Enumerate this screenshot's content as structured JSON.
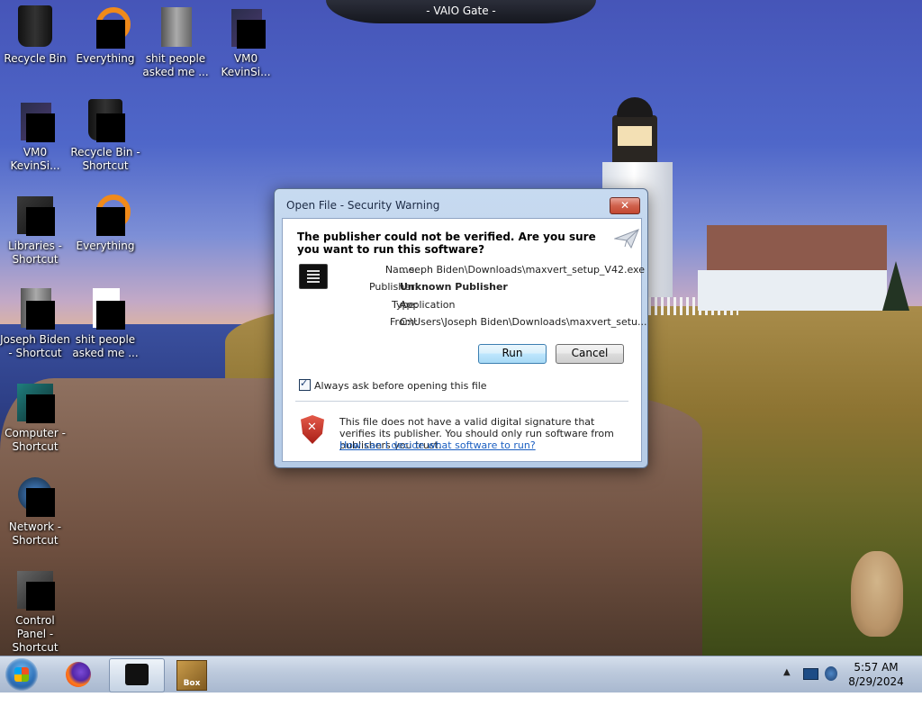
{
  "gadget": {
    "title": "- VAIO Gate -"
  },
  "desktop": {
    "icons": [
      {
        "label": "Recycle Bin"
      },
      {
        "label": "Everything"
      },
      {
        "label": "shit people asked me ..."
      },
      {
        "label": "VM0 KevinSi..."
      },
      {
        "label": "VM0 KevinSi..."
      },
      {
        "label": "Recycle Bin - Shortcut"
      },
      {
        "label": "Libraries - Shortcut"
      },
      {
        "label": "Everything"
      },
      {
        "label": "Joseph Biden - Shortcut"
      },
      {
        "label": "shit people asked me ..."
      },
      {
        "label": "Computer - Shortcut"
      },
      {
        "label": "Network - Shortcut"
      },
      {
        "label": "Control Panel - Shortcut"
      }
    ]
  },
  "dialog": {
    "title": "Open File - Security Warning",
    "close_label": "✕",
    "question": "The publisher could not be verified.  Are you sure you want to run this software?",
    "properties": [
      {
        "key": "Name:",
        "value": "...seph Biden\\Downloads\\maxvert_setup_V42.exe"
      },
      {
        "key": "Publisher:",
        "value": "Unknown Publisher"
      },
      {
        "key": "Type:",
        "value": "Application"
      },
      {
        "key": "From:",
        "value": "C:\\Users\\Joseph Biden\\Downloads\\maxvert_setu..."
      }
    ],
    "run_label": "Run",
    "cancel_label": "Cancel",
    "checkbox_label": "Always ask before opening this file",
    "checkbox_checked": true,
    "warning_text": "This file does not have a valid digital signature that verifies its publisher.  You should only run software from publishers you trust.",
    "help_link": "How can I decide what software to run?"
  },
  "taskbar": {
    "tray_arrow": "▲",
    "box_label": "Box",
    "time": "5:57 AM",
    "date": "8/29/2024"
  }
}
